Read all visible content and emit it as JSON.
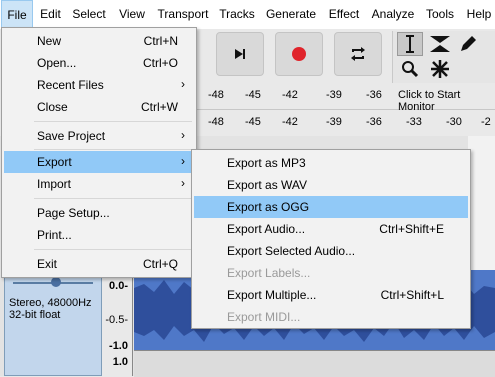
{
  "menubar": {
    "items": [
      "File",
      "Edit",
      "Select",
      "View",
      "Transport",
      "Tracks",
      "Generate",
      "Effect",
      "Analyze",
      "Tools",
      "Help"
    ]
  },
  "toolbar": {
    "buttons": [
      "skip-to-end-icon",
      "record-icon",
      "loop-icon"
    ],
    "tools": [
      "selection-tool-icon",
      "envelope-tool-icon",
      "draw-tool-icon",
      "zoom-tool-icon",
      "multi-tool-icon"
    ]
  },
  "meters": {
    "record_ticks": [
      "-48",
      "-45",
      "-42",
      "-39",
      "-36"
    ],
    "record_prompt": "Click to Start Monitor",
    "play_ticks": [
      "-48",
      "-45",
      "-42",
      "-39",
      "-36",
      "-33",
      "-30",
      "-2"
    ]
  },
  "track": {
    "info": "Stereo, 48000Hz\n32-bit float",
    "ruler": [
      "0.0-",
      "-0.5-",
      "-1.0",
      "1.0"
    ]
  },
  "file_menu": {
    "items": [
      {
        "label": "New",
        "shortcut": "Ctrl+N"
      },
      {
        "label": "Open...",
        "shortcut": "Ctrl+O"
      },
      {
        "label": "Recent Files",
        "shortcut": ""
      },
      {
        "label": "Close",
        "shortcut": "Ctrl+W"
      },
      {
        "label": "Save Project",
        "shortcut": ""
      },
      {
        "label": "Export",
        "shortcut": ""
      },
      {
        "label": "Import",
        "shortcut": ""
      },
      {
        "label": "Page Setup...",
        "shortcut": ""
      },
      {
        "label": "Print...",
        "shortcut": ""
      },
      {
        "label": "Exit",
        "shortcut": "Ctrl+Q"
      }
    ]
  },
  "export_menu": {
    "items": [
      {
        "label": "Export as MP3",
        "shortcut": ""
      },
      {
        "label": "Export as WAV",
        "shortcut": ""
      },
      {
        "label": "Export as OGG",
        "shortcut": ""
      },
      {
        "label": "Export Audio...",
        "shortcut": "Ctrl+Shift+E"
      },
      {
        "label": "Export Selected Audio...",
        "shortcut": ""
      },
      {
        "label": "Export Labels...",
        "shortcut": ""
      },
      {
        "label": "Export Multiple...",
        "shortcut": "Ctrl+Shift+L"
      },
      {
        "label": "Export MIDI...",
        "shortcut": ""
      }
    ]
  },
  "colors": {
    "highlight": "#91c9f7",
    "record": "#e0242b",
    "waveform": "#4f78c8"
  }
}
